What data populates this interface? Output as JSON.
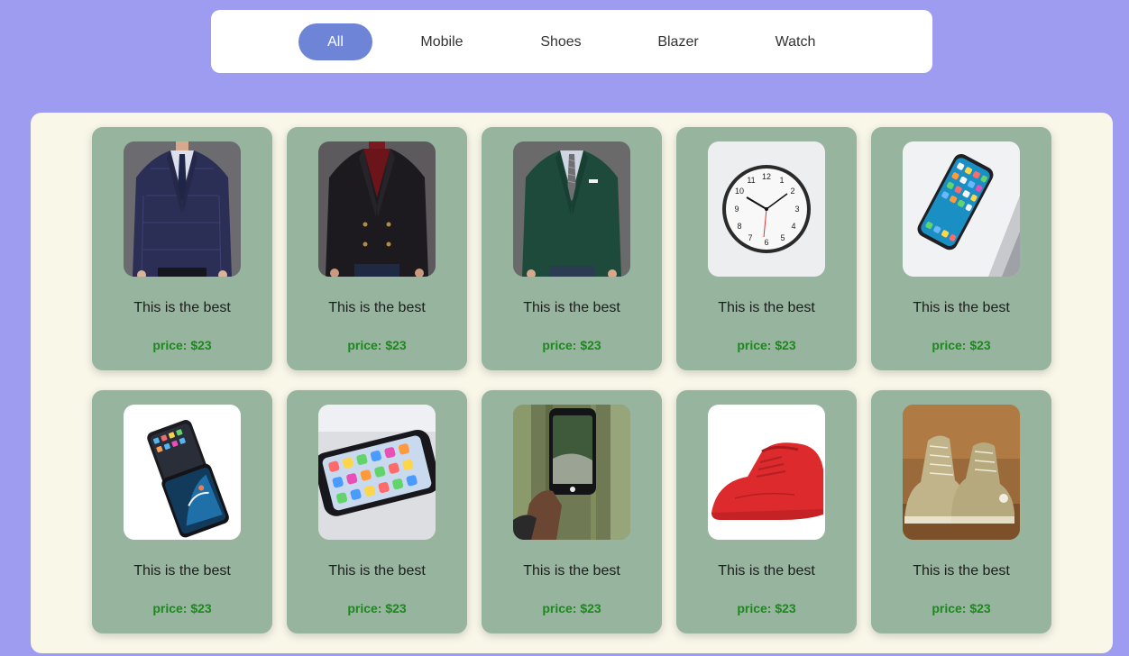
{
  "filters": [
    {
      "label": "All",
      "active": true
    },
    {
      "label": "Mobile",
      "active": false
    },
    {
      "label": "Shoes",
      "active": false
    },
    {
      "label": "Blazer",
      "active": false
    },
    {
      "label": "Watch",
      "active": false
    }
  ],
  "products": [
    {
      "image": "blazer-navy",
      "title": "This is the best",
      "price": "price: $23"
    },
    {
      "image": "blazer-black",
      "title": "This is the best",
      "price": "price: $23"
    },
    {
      "image": "blazer-green",
      "title": "This is the best",
      "price": "price: $23"
    },
    {
      "image": "wall-clock",
      "title": "This is the best",
      "price": "price: $23"
    },
    {
      "image": "phone-on-laptop",
      "title": "This is the best",
      "price": "price: $23"
    },
    {
      "image": "two-phones",
      "title": "This is the best",
      "price": "price: $23"
    },
    {
      "image": "phone-on-table",
      "title": "This is the best",
      "price": "price: $23"
    },
    {
      "image": "phone-in-hand",
      "title": "This is the best",
      "price": "price: $23"
    },
    {
      "image": "red-sneaker",
      "title": "This is the best",
      "price": "price: $23"
    },
    {
      "image": "canvas-sneakers",
      "title": "This is the best",
      "price": "price: $23"
    }
  ],
  "colors": {
    "page_background": "#9d9cf0",
    "active_filter": "#6e84d6",
    "panel": "#f9f7e8",
    "card": "#96b49e",
    "price_text": "#1a8a1a"
  }
}
